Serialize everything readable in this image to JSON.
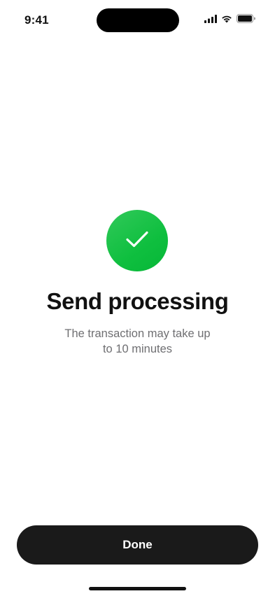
{
  "status_bar": {
    "time": "9:41",
    "icons": [
      "cellular-signal-icon",
      "wifi-icon",
      "battery-icon"
    ]
  },
  "success": {
    "icon": "checkmark-icon",
    "icon_color": "#14C03F",
    "title": "Send processing",
    "subtitle": "The transaction may take up to 10 minutes"
  },
  "actions": {
    "done_label": "Done",
    "button_color": "#1A1A1A"
  }
}
